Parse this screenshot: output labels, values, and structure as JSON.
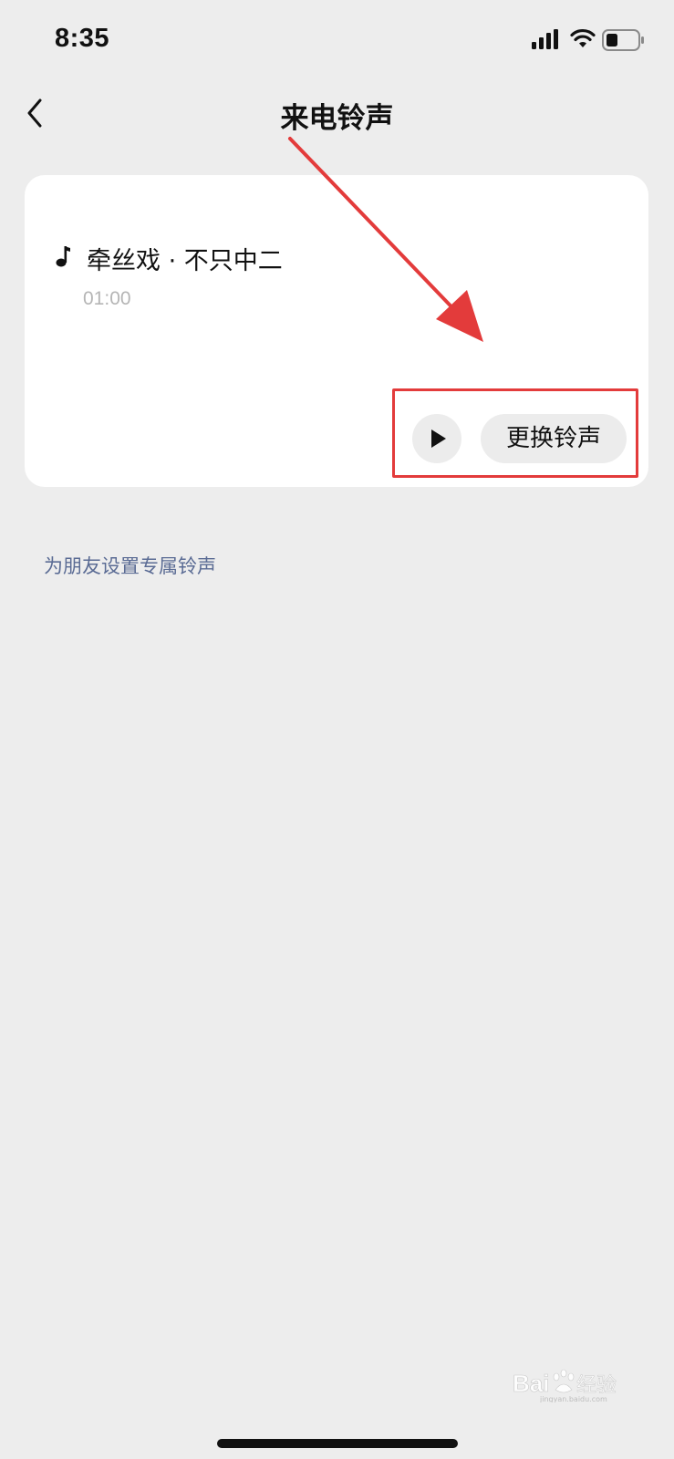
{
  "status_bar": {
    "time": "8:35",
    "icons": [
      "signal-icon",
      "wifi-icon",
      "battery-icon"
    ]
  },
  "nav": {
    "title": "来电铃声",
    "back_icon": "chevron-left-icon"
  },
  "ringtone": {
    "icon": "music-note-icon",
    "title": "牵丝戏 · 不只中二",
    "duration": "01:00",
    "play_icon": "play-icon",
    "change_label": "更换铃声"
  },
  "friend_link": {
    "label": "为朋友设置专属铃声"
  },
  "annotation": {
    "arrow_color": "#e33b3b",
    "box_color": "#e33b3b"
  },
  "watermark": {
    "text": "Baidu经验",
    "subtext": "jingyan.baidu.com"
  },
  "colors": {
    "background": "#ededed",
    "card": "#ffffff",
    "link": "#5a6b94",
    "button_bg": "#ececec",
    "duration": "#b5b5b5"
  }
}
